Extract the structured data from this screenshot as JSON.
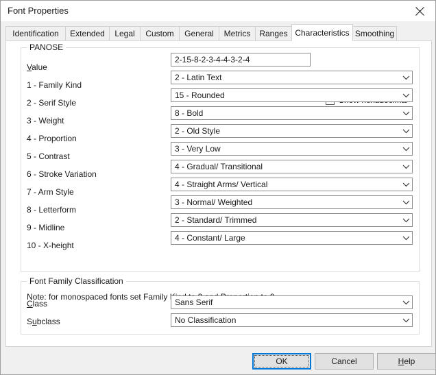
{
  "window": {
    "title": "Font Properties",
    "close_icon": "close-icon"
  },
  "tabs": [
    {
      "label": "Identification",
      "active": false
    },
    {
      "label": "Extended",
      "active": false
    },
    {
      "label": "Legal",
      "active": false
    },
    {
      "label": "Custom",
      "active": false
    },
    {
      "label": "General",
      "active": false
    },
    {
      "label": "Metrics",
      "active": false
    },
    {
      "label": "Ranges",
      "active": false
    },
    {
      "label": "Characteristics",
      "active": true
    },
    {
      "label": "Smoothing",
      "active": false
    }
  ],
  "panose": {
    "group_title": "PANOSE",
    "value_label_prefix": "V",
    "value_label_rest": "alue",
    "value": "2-15-8-2-3-4-4-3-2-4",
    "show_hex_label": "Show hexadecimal",
    "show_hex_checked": false,
    "rows": [
      {
        "label": "1 - Family Kind",
        "value": "2 - Latin Text"
      },
      {
        "label": "2 - Serif Style",
        "value": "15 - Rounded"
      },
      {
        "label": "3 - Weight",
        "value": "8 - Bold"
      },
      {
        "label": "4 - Proportion",
        "value": "2 - Old Style"
      },
      {
        "label": "5 - Contrast",
        "value": "3 - Very Low"
      },
      {
        "label": "6 - Stroke Variation",
        "value": "4 - Gradual/ Transitional"
      },
      {
        "label": "7 - Arm Style",
        "value": "4 - Straight Arms/ Vertical"
      },
      {
        "label": "8 - Letterform",
        "value": "3 - Normal/ Weighted"
      },
      {
        "label": "9 - Midline",
        "value": "2 - Standard/ Trimmed"
      },
      {
        "label": "10 - X-height",
        "value": "4 - Constant/ Large"
      }
    ],
    "note": "Note: for monospaced fonts set Family Kind to 2 and Proportion to 9."
  },
  "classification": {
    "group_title": "Font Family Classification",
    "class_label_prefix": "C",
    "class_label_rest": "lass",
    "class_value": "Sans Serif",
    "subclass_label_a": "S",
    "subclass_label_accel": "u",
    "subclass_label_b": "bclass",
    "subclass_value": "No Classification"
  },
  "footer": {
    "ok_label": "OK",
    "cancel_label": "Cancel",
    "help_label_accel": "H",
    "help_label_rest": "elp"
  },
  "colors": {
    "accent": "#0078d7",
    "window_bg": "#f0f0f0",
    "page_bg": "#ffffff",
    "border": "#8a8a8a"
  }
}
